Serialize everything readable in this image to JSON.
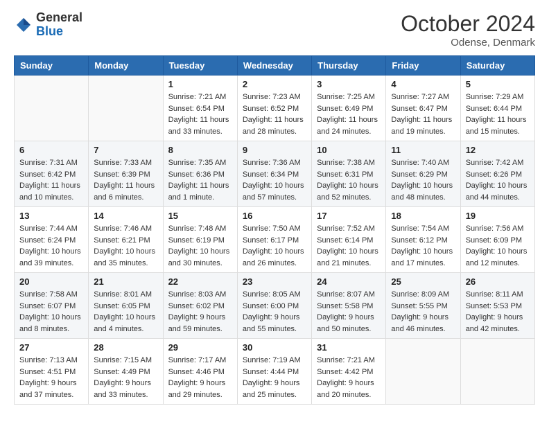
{
  "header": {
    "logo_general": "General",
    "logo_blue": "Blue",
    "month_title": "October 2024",
    "location": "Odense, Denmark"
  },
  "weekdays": [
    "Sunday",
    "Monday",
    "Tuesday",
    "Wednesday",
    "Thursday",
    "Friday",
    "Saturday"
  ],
  "weeks": [
    [
      {
        "day": "",
        "sunrise": "",
        "sunset": "",
        "daylight": ""
      },
      {
        "day": "",
        "sunrise": "",
        "sunset": "",
        "daylight": ""
      },
      {
        "day": "1",
        "sunrise": "Sunrise: 7:21 AM",
        "sunset": "Sunset: 6:54 PM",
        "daylight": "Daylight: 11 hours and 33 minutes."
      },
      {
        "day": "2",
        "sunrise": "Sunrise: 7:23 AM",
        "sunset": "Sunset: 6:52 PM",
        "daylight": "Daylight: 11 hours and 28 minutes."
      },
      {
        "day": "3",
        "sunrise": "Sunrise: 7:25 AM",
        "sunset": "Sunset: 6:49 PM",
        "daylight": "Daylight: 11 hours and 24 minutes."
      },
      {
        "day": "4",
        "sunrise": "Sunrise: 7:27 AM",
        "sunset": "Sunset: 6:47 PM",
        "daylight": "Daylight: 11 hours and 19 minutes."
      },
      {
        "day": "5",
        "sunrise": "Sunrise: 7:29 AM",
        "sunset": "Sunset: 6:44 PM",
        "daylight": "Daylight: 11 hours and 15 minutes."
      }
    ],
    [
      {
        "day": "6",
        "sunrise": "Sunrise: 7:31 AM",
        "sunset": "Sunset: 6:42 PM",
        "daylight": "Daylight: 11 hours and 10 minutes."
      },
      {
        "day": "7",
        "sunrise": "Sunrise: 7:33 AM",
        "sunset": "Sunset: 6:39 PM",
        "daylight": "Daylight: 11 hours and 6 minutes."
      },
      {
        "day": "8",
        "sunrise": "Sunrise: 7:35 AM",
        "sunset": "Sunset: 6:36 PM",
        "daylight": "Daylight: 11 hours and 1 minute."
      },
      {
        "day": "9",
        "sunrise": "Sunrise: 7:36 AM",
        "sunset": "Sunset: 6:34 PM",
        "daylight": "Daylight: 10 hours and 57 minutes."
      },
      {
        "day": "10",
        "sunrise": "Sunrise: 7:38 AM",
        "sunset": "Sunset: 6:31 PM",
        "daylight": "Daylight: 10 hours and 52 minutes."
      },
      {
        "day": "11",
        "sunrise": "Sunrise: 7:40 AM",
        "sunset": "Sunset: 6:29 PM",
        "daylight": "Daylight: 10 hours and 48 minutes."
      },
      {
        "day": "12",
        "sunrise": "Sunrise: 7:42 AM",
        "sunset": "Sunset: 6:26 PM",
        "daylight": "Daylight: 10 hours and 44 minutes."
      }
    ],
    [
      {
        "day": "13",
        "sunrise": "Sunrise: 7:44 AM",
        "sunset": "Sunset: 6:24 PM",
        "daylight": "Daylight: 10 hours and 39 minutes."
      },
      {
        "day": "14",
        "sunrise": "Sunrise: 7:46 AM",
        "sunset": "Sunset: 6:21 PM",
        "daylight": "Daylight: 10 hours and 35 minutes."
      },
      {
        "day": "15",
        "sunrise": "Sunrise: 7:48 AM",
        "sunset": "Sunset: 6:19 PM",
        "daylight": "Daylight: 10 hours and 30 minutes."
      },
      {
        "day": "16",
        "sunrise": "Sunrise: 7:50 AM",
        "sunset": "Sunset: 6:17 PM",
        "daylight": "Daylight: 10 hours and 26 minutes."
      },
      {
        "day": "17",
        "sunrise": "Sunrise: 7:52 AM",
        "sunset": "Sunset: 6:14 PM",
        "daylight": "Daylight: 10 hours and 21 minutes."
      },
      {
        "day": "18",
        "sunrise": "Sunrise: 7:54 AM",
        "sunset": "Sunset: 6:12 PM",
        "daylight": "Daylight: 10 hours and 17 minutes."
      },
      {
        "day": "19",
        "sunrise": "Sunrise: 7:56 AM",
        "sunset": "Sunset: 6:09 PM",
        "daylight": "Daylight: 10 hours and 12 minutes."
      }
    ],
    [
      {
        "day": "20",
        "sunrise": "Sunrise: 7:58 AM",
        "sunset": "Sunset: 6:07 PM",
        "daylight": "Daylight: 10 hours and 8 minutes."
      },
      {
        "day": "21",
        "sunrise": "Sunrise: 8:01 AM",
        "sunset": "Sunset: 6:05 PM",
        "daylight": "Daylight: 10 hours and 4 minutes."
      },
      {
        "day": "22",
        "sunrise": "Sunrise: 8:03 AM",
        "sunset": "Sunset: 6:02 PM",
        "daylight": "Daylight: 9 hours and 59 minutes."
      },
      {
        "day": "23",
        "sunrise": "Sunrise: 8:05 AM",
        "sunset": "Sunset: 6:00 PM",
        "daylight": "Daylight: 9 hours and 55 minutes."
      },
      {
        "day": "24",
        "sunrise": "Sunrise: 8:07 AM",
        "sunset": "Sunset: 5:58 PM",
        "daylight": "Daylight: 9 hours and 50 minutes."
      },
      {
        "day": "25",
        "sunrise": "Sunrise: 8:09 AM",
        "sunset": "Sunset: 5:55 PM",
        "daylight": "Daylight: 9 hours and 46 minutes."
      },
      {
        "day": "26",
        "sunrise": "Sunrise: 8:11 AM",
        "sunset": "Sunset: 5:53 PM",
        "daylight": "Daylight: 9 hours and 42 minutes."
      }
    ],
    [
      {
        "day": "27",
        "sunrise": "Sunrise: 7:13 AM",
        "sunset": "Sunset: 4:51 PM",
        "daylight": "Daylight: 9 hours and 37 minutes."
      },
      {
        "day": "28",
        "sunrise": "Sunrise: 7:15 AM",
        "sunset": "Sunset: 4:49 PM",
        "daylight": "Daylight: 9 hours and 33 minutes."
      },
      {
        "day": "29",
        "sunrise": "Sunrise: 7:17 AM",
        "sunset": "Sunset: 4:46 PM",
        "daylight": "Daylight: 9 hours and 29 minutes."
      },
      {
        "day": "30",
        "sunrise": "Sunrise: 7:19 AM",
        "sunset": "Sunset: 4:44 PM",
        "daylight": "Daylight: 9 hours and 25 minutes."
      },
      {
        "day": "31",
        "sunrise": "Sunrise: 7:21 AM",
        "sunset": "Sunset: 4:42 PM",
        "daylight": "Daylight: 9 hours and 20 minutes."
      },
      {
        "day": "",
        "sunrise": "",
        "sunset": "",
        "daylight": ""
      },
      {
        "day": "",
        "sunrise": "",
        "sunset": "",
        "daylight": ""
      }
    ]
  ]
}
